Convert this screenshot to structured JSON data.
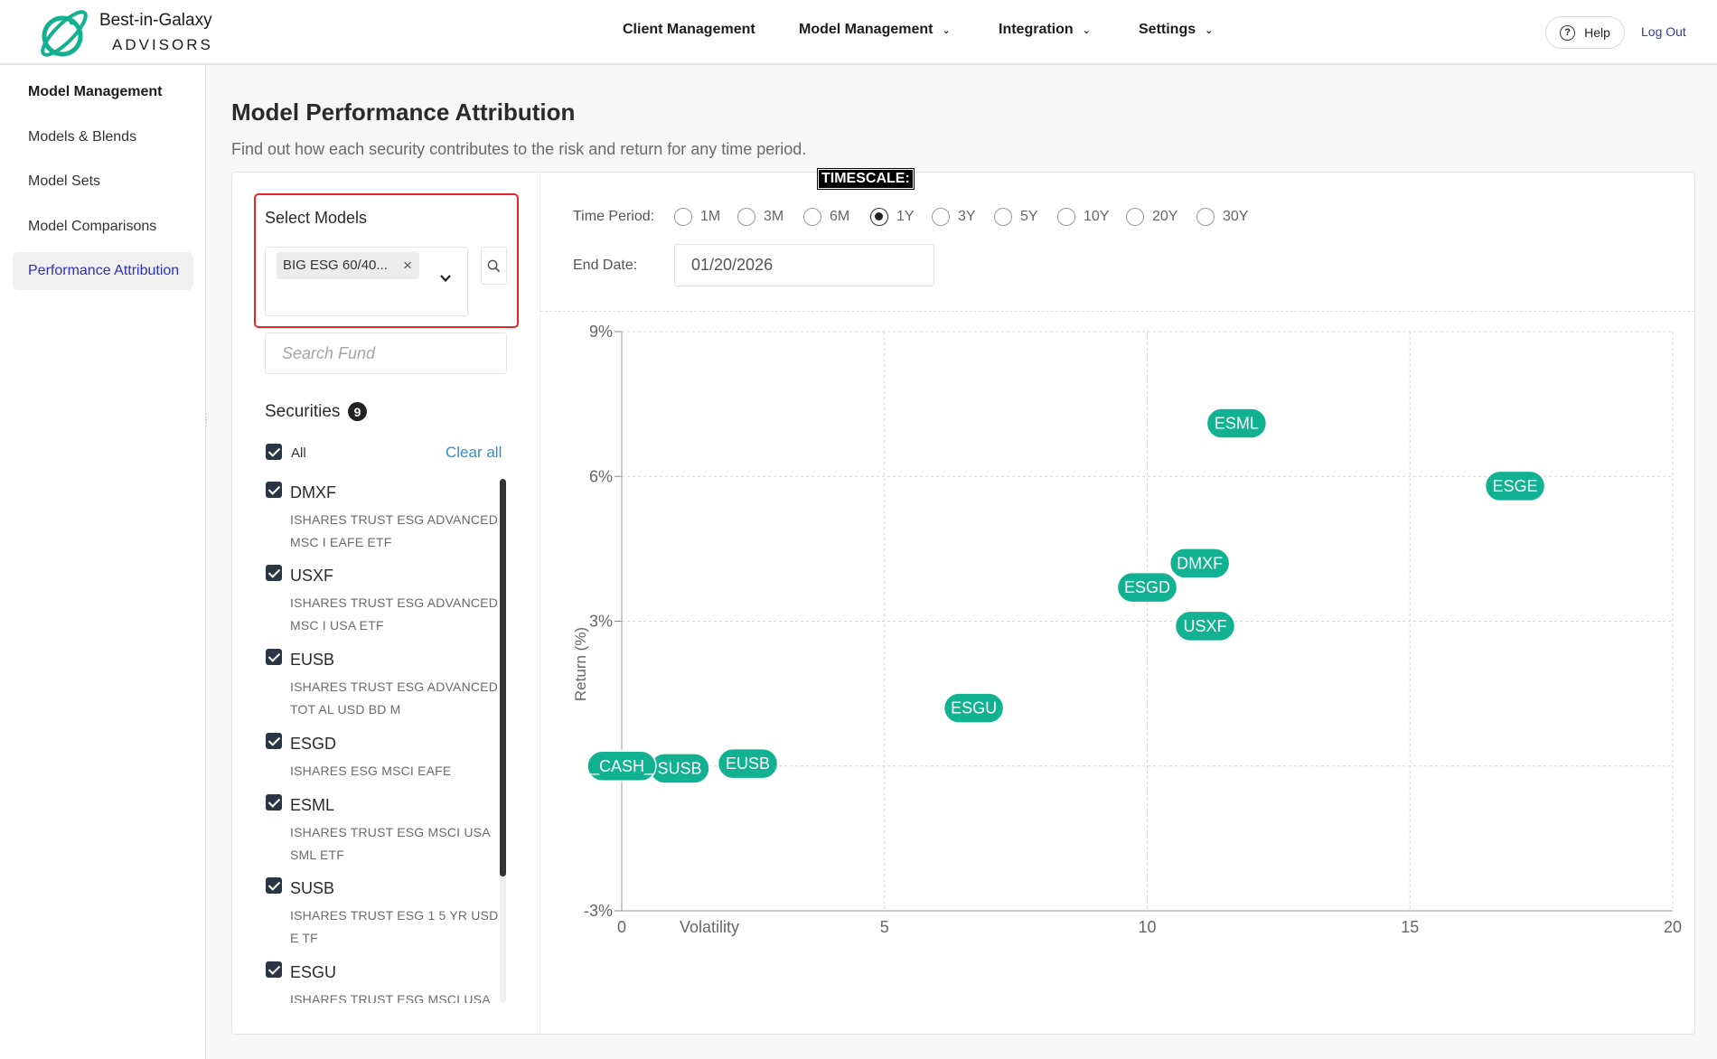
{
  "header": {
    "brand_name": "Best-in-Galaxy",
    "brand_sub": "ADVISORS",
    "nav": [
      "Client Management",
      "Model Management",
      "Integration",
      "Settings"
    ],
    "help_label": "Help",
    "logout_label": "Log Out"
  },
  "sidebar": {
    "heading": "Model Management",
    "items": [
      "Models & Blends",
      "Model Sets",
      "Model Comparisons",
      "Performance Attribution"
    ],
    "active_index": 3
  },
  "page": {
    "title": "Model Performance Attribution",
    "subtitle": "Find out how each security contributes to the risk and return for any time period.",
    "timescale_tag": "TIMESCALE:"
  },
  "select_models": {
    "label": "Select Models",
    "chip": "BIG ESG 60/40...",
    "chip_remove": "×",
    "search_placeholder": "Search Fund"
  },
  "securities": {
    "title": "Securities",
    "count": "9",
    "all_label": "All",
    "clear_all": "Clear all",
    "items": [
      {
        "symbol": "DMXF",
        "name": "ISHARES TRUST ESG ADVANCED MSC I EAFE ETF"
      },
      {
        "symbol": "USXF",
        "name": "ISHARES TRUST ESG ADVANCED MSC I USA ETF"
      },
      {
        "symbol": "EUSB",
        "name": "ISHARES TRUST ESG ADVANCED TOT AL USD BD M"
      },
      {
        "symbol": "ESGD",
        "name": "ISHARES ESG MSCI EAFE"
      },
      {
        "symbol": "ESML",
        "name": "ISHARES TRUST ESG MSCI USA SML ETF"
      },
      {
        "symbol": "SUSB",
        "name": "ISHARES TRUST ESG 1 5 YR USD E TF"
      },
      {
        "symbol": "ESGU",
        "name": "ISHARES TRUST ESG MSCI USA"
      }
    ]
  },
  "controls": {
    "time_period_label": "Time Period:",
    "periods": [
      "1M",
      "3M",
      "6M",
      "1Y",
      "3Y",
      "5Y",
      "10Y",
      "20Y",
      "30Y"
    ],
    "selected_period": "1Y",
    "end_date_label": "End Date:",
    "end_date": "01/20/2026"
  },
  "colors": {
    "accent": "#11b192",
    "highlight": "#e8252a",
    "link": "#2e8fc9",
    "active_nav": "#2b35b0"
  },
  "chart_data": {
    "type": "scatter",
    "xlabel": "Volatility",
    "ylabel": "Return (%)",
    "xlim": [
      0,
      20
    ],
    "ylim": [
      -3,
      9
    ],
    "xticks": [
      "0",
      "5",
      "10",
      "15",
      "20"
    ],
    "yticks": [
      "-3%",
      "3%",
      "6%",
      "9%"
    ],
    "grid": true,
    "points": [
      {
        "label": "ESML",
        "x": 11.7,
        "y": 7.1
      },
      {
        "label": "ESGE",
        "x": 17.0,
        "y": 5.8
      },
      {
        "label": "DMXF",
        "x": 11.0,
        "y": 4.2
      },
      {
        "label": "ESGD",
        "x": 10.0,
        "y": 3.7
      },
      {
        "label": "USXF",
        "x": 11.1,
        "y": 2.9
      },
      {
        "label": "ESGU",
        "x": 6.7,
        "y": 1.2
      },
      {
        "label": "EUSB",
        "x": 2.4,
        "y": 0.05
      },
      {
        "label": "SUSB",
        "x": 1.1,
        "y": -0.05
      },
      {
        "label": "_CASH_",
        "x": 0.0,
        "y": 0.0
      }
    ]
  }
}
